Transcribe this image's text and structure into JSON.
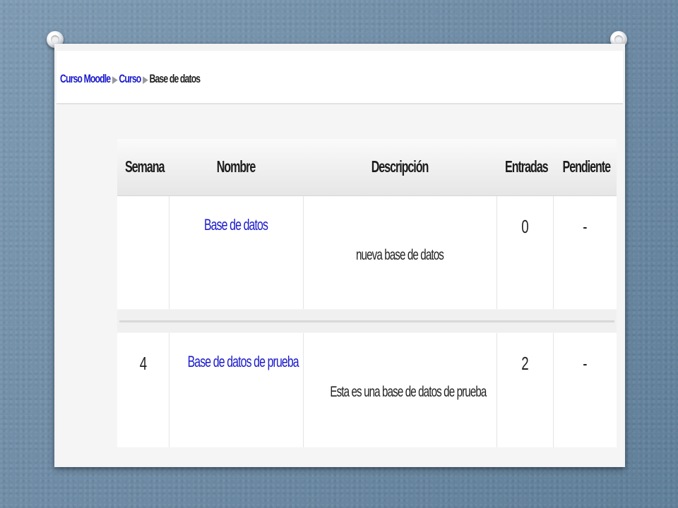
{
  "breadcrumb": {
    "items": [
      "Curso Moodle",
      "Curso"
    ],
    "current": "Base de datos"
  },
  "table": {
    "headers": [
      "Semana",
      "Nombre",
      "Descripción",
      "Entradas",
      "Pendiente"
    ],
    "rows": [
      {
        "semana": "",
        "nombre": "Base de datos",
        "descripcion": "nueva base de datos",
        "entradas": "0",
        "pendiente": "-"
      },
      {
        "semana": "4",
        "nombre": "Base de datos de prueba",
        "descripcion": "Esta es una base de datos de prueba",
        "entradas": "2",
        "pendiente": "-"
      }
    ]
  },
  "colors": {
    "link": "#1a1acd",
    "background": "#6f8ca6"
  }
}
